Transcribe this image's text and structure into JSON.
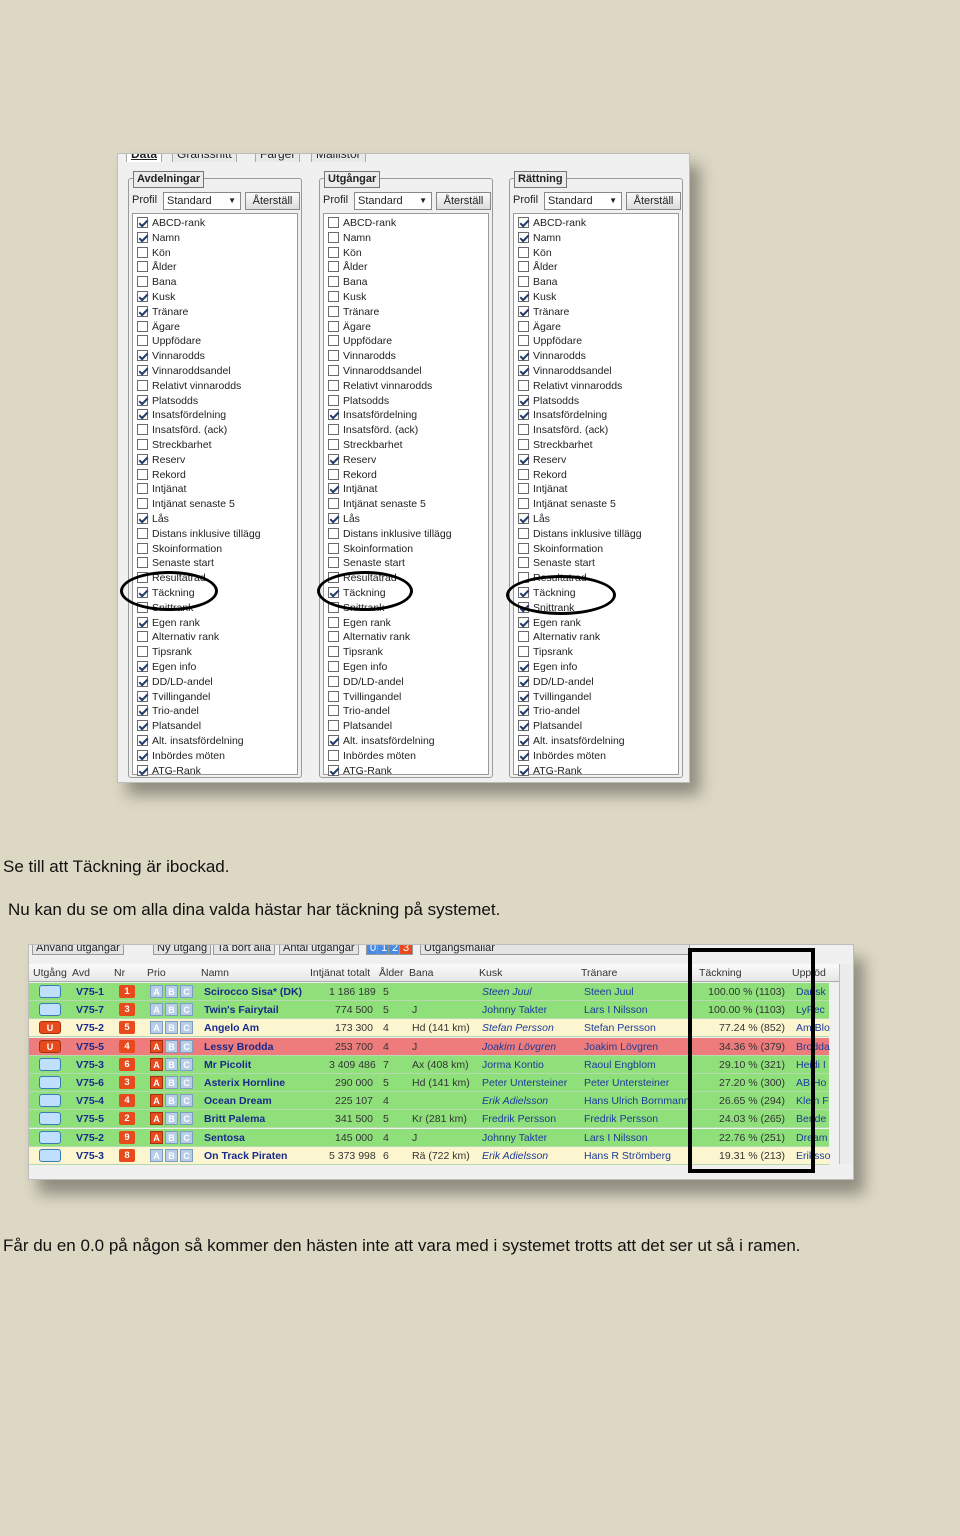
{
  "settings": {
    "tabs": [
      "Data",
      "Gränssnitt",
      "Färger",
      "Mallistor"
    ],
    "profile_label": "Profil",
    "profile_value": "Standard",
    "reset_label": "Återställ",
    "panels": [
      {
        "title": "Avdelningar",
        "items": [
          {
            "label": "ABCD-rank",
            "checked": true
          },
          {
            "label": "Namn",
            "checked": true
          },
          {
            "label": "Kön",
            "checked": false
          },
          {
            "label": "Ålder",
            "checked": false
          },
          {
            "label": "Bana",
            "checked": false
          },
          {
            "label": "Kusk",
            "checked": true
          },
          {
            "label": "Tränare",
            "checked": true
          },
          {
            "label": "Ägare",
            "checked": false
          },
          {
            "label": "Uppfödare",
            "checked": false
          },
          {
            "label": "Vinnarodds",
            "checked": true
          },
          {
            "label": "Vinnaroddsandel",
            "checked": true
          },
          {
            "label": "Relativt vinnarodds",
            "checked": false
          },
          {
            "label": "Platsodds",
            "checked": true
          },
          {
            "label": "Insatsfördelning",
            "checked": true
          },
          {
            "label": "Insatsförd. (ack)",
            "checked": false
          },
          {
            "label": "Streckbarhet",
            "checked": false
          },
          {
            "label": "Reserv",
            "checked": true
          },
          {
            "label": "Rekord",
            "checked": false
          },
          {
            "label": "Intjänat",
            "checked": false
          },
          {
            "label": "Intjänat senaste 5",
            "checked": false
          },
          {
            "label": "Lås",
            "checked": true
          },
          {
            "label": "Distans inklusive tillägg",
            "checked": false
          },
          {
            "label": "Skoinformation",
            "checked": false
          },
          {
            "label": "Senaste start",
            "checked": false
          },
          {
            "label": "Resultatrad",
            "checked": false
          },
          {
            "label": "Täckning",
            "checked": true
          },
          {
            "label": "Snittrank",
            "checked": false
          },
          {
            "label": "Egen rank",
            "checked": true
          },
          {
            "label": "Alternativ rank",
            "checked": false
          },
          {
            "label": "Tipsrank",
            "checked": false
          },
          {
            "label": "Egen info",
            "checked": true
          },
          {
            "label": "DD/LD-andel",
            "checked": true
          },
          {
            "label": "Tvillingandel",
            "checked": true
          },
          {
            "label": "Trio-andel",
            "checked": true
          },
          {
            "label": "Platsandel",
            "checked": true
          },
          {
            "label": "Alt. insatsfördelning",
            "checked": true
          },
          {
            "label": "Inbördes möten",
            "checked": true
          },
          {
            "label": "ATG-Rank",
            "checked": true
          }
        ]
      },
      {
        "title": "Utgångar",
        "items": [
          {
            "label": "ABCD-rank",
            "checked": false
          },
          {
            "label": "Namn",
            "checked": false
          },
          {
            "label": "Kön",
            "checked": false
          },
          {
            "label": "Ålder",
            "checked": false
          },
          {
            "label": "Bana",
            "checked": false
          },
          {
            "label": "Kusk",
            "checked": false
          },
          {
            "label": "Tränare",
            "checked": false
          },
          {
            "label": "Ägare",
            "checked": false
          },
          {
            "label": "Uppfödare",
            "checked": false
          },
          {
            "label": "Vinnarodds",
            "checked": false
          },
          {
            "label": "Vinnaroddsandel",
            "checked": false
          },
          {
            "label": "Relativt vinnarodds",
            "checked": false
          },
          {
            "label": "Platsodds",
            "checked": false
          },
          {
            "label": "Insatsfördelning",
            "checked": true
          },
          {
            "label": "Insatsförd. (ack)",
            "checked": false
          },
          {
            "label": "Streckbarhet",
            "checked": false
          },
          {
            "label": "Reserv",
            "checked": true
          },
          {
            "label": "Rekord",
            "checked": false
          },
          {
            "label": "Intjänat",
            "checked": true
          },
          {
            "label": "Intjänat senaste 5",
            "checked": false
          },
          {
            "label": "Lås",
            "checked": true
          },
          {
            "label": "Distans inklusive tillägg",
            "checked": false
          },
          {
            "label": "Skoinformation",
            "checked": false
          },
          {
            "label": "Senaste start",
            "checked": false
          },
          {
            "label": "Resultatrad",
            "checked": false
          },
          {
            "label": "Täckning",
            "checked": true
          },
          {
            "label": "Snittrank",
            "checked": false
          },
          {
            "label": "Egen rank",
            "checked": false
          },
          {
            "label": "Alternativ rank",
            "checked": false
          },
          {
            "label": "Tipsrank",
            "checked": false
          },
          {
            "label": "Egen info",
            "checked": false
          },
          {
            "label": "DD/LD-andel",
            "checked": false
          },
          {
            "label": "Tvillingandel",
            "checked": false
          },
          {
            "label": "Trio-andel",
            "checked": false
          },
          {
            "label": "Platsandel",
            "checked": false
          },
          {
            "label": "Alt. insatsfördelning",
            "checked": true
          },
          {
            "label": "Inbördes möten",
            "checked": false
          },
          {
            "label": "ATG-Rank",
            "checked": true
          }
        ]
      },
      {
        "title": "Rättning",
        "items": [
          {
            "label": "ABCD-rank",
            "checked": true
          },
          {
            "label": "Namn",
            "checked": true
          },
          {
            "label": "Kön",
            "checked": false
          },
          {
            "label": "Ålder",
            "checked": false
          },
          {
            "label": "Bana",
            "checked": false
          },
          {
            "label": "Kusk",
            "checked": true
          },
          {
            "label": "Tränare",
            "checked": true
          },
          {
            "label": "Ägare",
            "checked": false
          },
          {
            "label": "Uppfödare",
            "checked": false
          },
          {
            "label": "Vinnarodds",
            "checked": true
          },
          {
            "label": "Vinnaroddsandel",
            "checked": true
          },
          {
            "label": "Relativt vinnarodds",
            "checked": false
          },
          {
            "label": "Platsodds",
            "checked": true
          },
          {
            "label": "Insatsfördelning",
            "checked": true
          },
          {
            "label": "Insatsförd. (ack)",
            "checked": false
          },
          {
            "label": "Streckbarhet",
            "checked": false
          },
          {
            "label": "Reserv",
            "checked": true
          },
          {
            "label": "Rekord",
            "checked": false
          },
          {
            "label": "Intjänat",
            "checked": false
          },
          {
            "label": "Intjänat senaste 5",
            "checked": false
          },
          {
            "label": "Lås",
            "checked": true
          },
          {
            "label": "Distans inklusive tillägg",
            "checked": false
          },
          {
            "label": "Skoinformation",
            "checked": false
          },
          {
            "label": "Senaste start",
            "checked": false
          },
          {
            "label": "Resultatrad",
            "checked": false
          },
          {
            "label": "Täckning",
            "checked": true
          },
          {
            "label": "Snittrank",
            "checked": true
          },
          {
            "label": "Egen rank",
            "checked": true
          },
          {
            "label": "Alternativ rank",
            "checked": false
          },
          {
            "label": "Tipsrank",
            "checked": false
          },
          {
            "label": "Egen info",
            "checked": true
          },
          {
            "label": "DD/LD-andel",
            "checked": true
          },
          {
            "label": "Tvillingandel",
            "checked": true
          },
          {
            "label": "Trio-andel",
            "checked": true
          },
          {
            "label": "Platsandel",
            "checked": true
          },
          {
            "label": "Alt. insatsfördelning",
            "checked": true
          },
          {
            "label": "Inbördes möten",
            "checked": true
          },
          {
            "label": "ATG-Rank",
            "checked": true
          }
        ]
      }
    ]
  },
  "text": {
    "p1": "Se till att Täckning är ibockad.",
    "p2": "Nu kan du se om alla dina valda hästar har täckning på systemet.",
    "p3": "Får du en 0.0 på någon så kommer den hästen inte att vara med i systemet trotts att det ser ut så i ramen."
  },
  "table": {
    "toolbar": [
      "Använd utgångar",
      "Ny utgång",
      "Ta bort alla",
      "Antal utgångar",
      "Utgångsmallar"
    ],
    "count_tabs": [
      "0",
      "1",
      "2",
      "3"
    ],
    "headers": [
      "Utgång",
      "Avd",
      "Nr",
      "Prio",
      "Namn",
      "Intjänat totalt",
      "Ålder",
      "Bana",
      "Kusk",
      "Tränare",
      "Täckning",
      "Uppföd"
    ],
    "rows": [
      {
        "utg": "",
        "avd": "V75-1",
        "nr": "1",
        "prio": "",
        "name": "Scirocco Sisa* (DK)",
        "earn": "1 186 189",
        "age": "5",
        "bana": "",
        "kusk": "Steen Juul",
        "kusk_italic": true,
        "trainer": "Steen Juul",
        "cover": "100.00 % (1103)",
        "upp": "Dansk",
        "color": "green"
      },
      {
        "utg": "",
        "avd": "V75-7",
        "nr": "3",
        "prio": "",
        "name": "Twin's Fairytail",
        "earn": "774 500",
        "age": "5",
        "bana": "J",
        "kusk": "Johnny Takter",
        "kusk_italic": false,
        "trainer": "Lars I Nilsson",
        "cover": "100.00 % (1103)",
        "upp": "LyPec",
        "color": "green"
      },
      {
        "utg": "U",
        "avd": "V75-2",
        "nr": "5",
        "prio": "",
        "name": "Angelo Am",
        "earn": "173 300",
        "age": "4",
        "bana": "Hd (141 km)",
        "kusk": "Stefan Persson",
        "kusk_italic": true,
        "trainer": "Stefan Persson",
        "cover": "77.24 % (852)",
        "upp": "Am Blo",
        "color": "yellow"
      },
      {
        "utg": "U",
        "avd": "V75-5",
        "nr": "4",
        "prio": "A",
        "name": "Lessy Brodda",
        "earn": "253 700",
        "age": "4",
        "bana": "J",
        "kusk": "Joakim Lövgren",
        "kusk_italic": true,
        "trainer": "Joakim Lövgren",
        "cover": "34.36 % (379)",
        "upp": "Brodda",
        "color": "red"
      },
      {
        "utg": "",
        "avd": "V75-3",
        "nr": "6",
        "prio": "A",
        "name": "Mr Picolit",
        "earn": "3 409 486",
        "age": "7",
        "bana": "Ax (408 km)",
        "kusk": "Jorma Kontio",
        "kusk_italic": false,
        "trainer": "Raoul Engblom",
        "cover": "29.10 % (321)",
        "upp": "Heidi I",
        "color": "green"
      },
      {
        "utg": "",
        "avd": "V75-6",
        "nr": "3",
        "prio": "A",
        "name": "Asterix Hornline",
        "earn": "290 000",
        "age": "5",
        "bana": "Hd (141 km)",
        "kusk": "Peter Untersteiner",
        "kusk_italic": false,
        "trainer": "Peter Untersteiner",
        "cover": "27.20 % (300)",
        "upp": "AB Ho",
        "color": "green"
      },
      {
        "utg": "",
        "avd": "V75-4",
        "nr": "4",
        "prio": "A",
        "name": "Ocean Dream",
        "earn": "225 107",
        "age": "4",
        "bana": "",
        "kusk": "Erik Adielsson",
        "kusk_italic": true,
        "trainer": "Hans Ulrich Bornmann",
        "cover": "26.65 % (294)",
        "upp": "Klein F",
        "color": "green"
      },
      {
        "utg": "",
        "avd": "V75-5",
        "nr": "2",
        "prio": "A",
        "name": "Britt Palema",
        "earn": "341 500",
        "age": "5",
        "bana": "Kr (281 km)",
        "kusk": "Fredrik Persson",
        "kusk_italic": false,
        "trainer": "Fredrik Persson",
        "cover": "24.03 % (265)",
        "upp": "Bende",
        "color": "green"
      },
      {
        "utg": "",
        "avd": "V75-2",
        "nr": "9",
        "prio": "A",
        "name": "Sentosa",
        "earn": "145 000",
        "age": "4",
        "bana": "J",
        "kusk": "Johnny Takter",
        "kusk_italic": false,
        "trainer": "Lars I Nilsson",
        "cover": "22.76 % (251)",
        "upp": "Dream",
        "color": "green"
      },
      {
        "utg": "",
        "avd": "V75-3",
        "nr": "8",
        "prio": "",
        "name": "On Track Piraten",
        "earn": "5 373 998",
        "age": "6",
        "bana": "Rä (722 km)",
        "kusk": "Erik Adielsson",
        "kusk_italic": true,
        "trainer": "Hans R Strömberg",
        "cover": "19.31 % (213)",
        "upp": "Eriksso",
        "color": "yellow"
      }
    ]
  },
  "colors": {
    "page_bg": "#ddd8c4",
    "row_green": "#8fe07b",
    "row_yellow": "#fbf6cf",
    "row_red": "#ee7c7c",
    "nr_badge": "#e84a1c"
  }
}
